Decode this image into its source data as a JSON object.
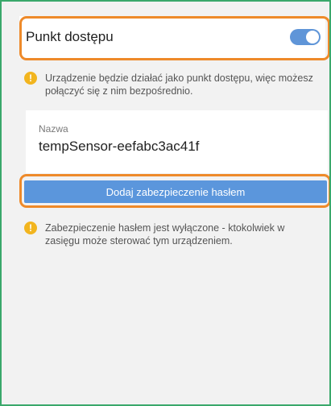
{
  "access_point": {
    "label": "Punkt dostępu",
    "enabled": true,
    "info": "Urządzenie będzie działać jako punkt dostępu, więc możesz połączyć się z nim bezpośrednio."
  },
  "name_field": {
    "label": "Nazwa",
    "value": "tempSensor-eefabc3ac41f"
  },
  "password_button": {
    "label": "Dodaj zabezpieczenie hasłem"
  },
  "password_info": "Zabezpieczenie hasłem jest wyłączone - ktokolwiek w zasięgu może sterować tym urządzeniem.",
  "icons": {
    "warning": "!"
  },
  "colors": {
    "toggle_on": "#5f95d8",
    "button": "#5b96dc",
    "warning_icon": "#f2b51f",
    "highlight": "#ee8a2a",
    "frame": "#3aa86b"
  }
}
